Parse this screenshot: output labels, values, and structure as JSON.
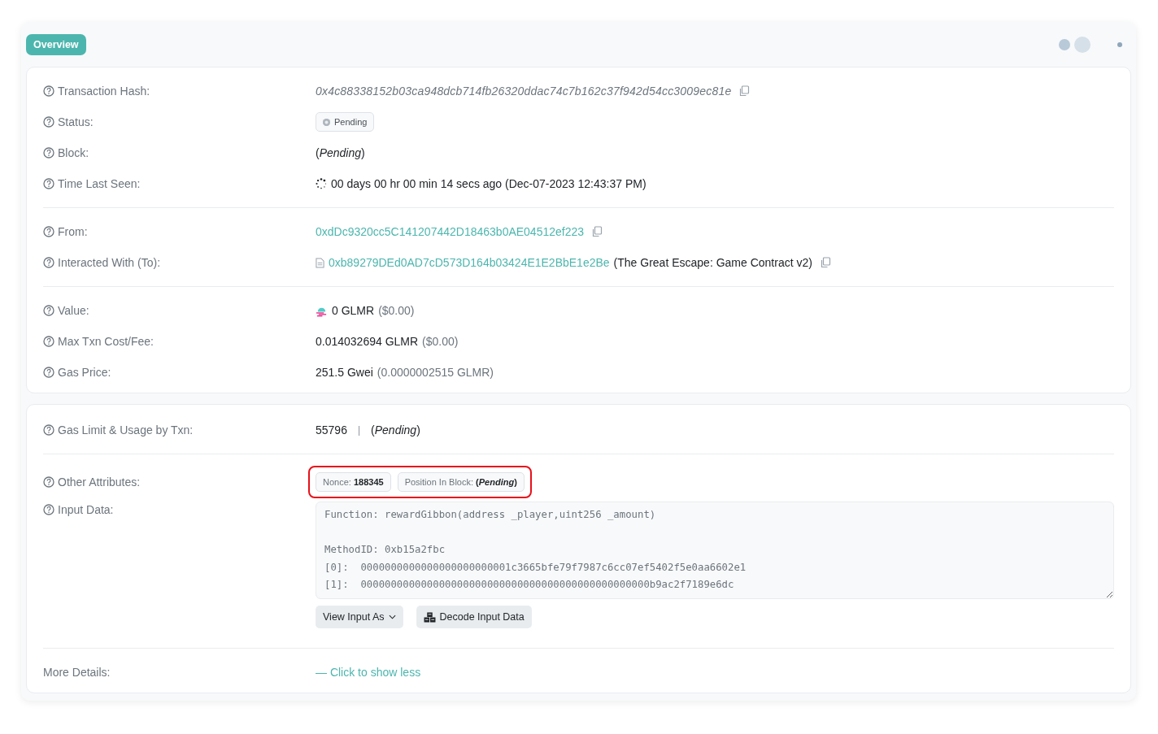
{
  "tabs": [
    {
      "label": "Overview",
      "selected": true
    }
  ],
  "overview": {
    "groups": [
      [
        {
          "kind": "hash",
          "label": "Transaction Hash:",
          "value": "0x4c88338152b03ca948dcb714fb26320ddac74c7b162c37f942d54cc3009ec81e"
        },
        {
          "kind": "status",
          "label": "Status:",
          "value": "Pending"
        },
        {
          "kind": "rich",
          "label": "Block:",
          "value": "(*Pending*)"
        },
        {
          "kind": "time",
          "label": "Time Last Seen:",
          "value": "00 days 00 hr 00 min 14 secs ago (Dec-07-2023 12:43:37 PM)"
        }
      ],
      [
        {
          "kind": "address",
          "label": "From:",
          "value": "0xdDc9320cc5C141207442D18463b0AE04512ef223"
        },
        {
          "kind": "contract",
          "label": "Interacted With (To):",
          "value": "0xb89279DEd0AD7cD573D164b03424E1E2BbE1e2Be",
          "note": "(The Great Escape: Game Contract v2)"
        }
      ],
      [
        {
          "kind": "token",
          "label": "Value:",
          "value": "0 GLMR",
          "note": "($0.00)"
        },
        {
          "kind": "amount",
          "label": "Max Txn Cost/Fee:",
          "value": "0.014032694 GLMR",
          "note": "($0.00)"
        },
        {
          "kind": "amount",
          "label": "Gas Price:",
          "value": "251.5 Gwei",
          "note": "(0.0000002515 GLMR)"
        }
      ]
    ]
  },
  "usage": {
    "gas": {
      "label": "Gas Limit & Usage by Txn:",
      "limit": "55796",
      "separator": "|",
      "usage": "(*Pending*)"
    },
    "attributes": {
      "label": "Other Attributes:",
      "highlighted": true,
      "badges": [
        {
          "label": "Nonce:",
          "value": "188345"
        },
        {
          "label": "Position In Block:",
          "value": "(*Pending*)"
        }
      ]
    },
    "input": {
      "label": "Input Data:",
      "blocks": [
        [
          "Function: rewardGibbon(address _player,uint256 _amount)"
        ],
        [
          "MethodID: 0xb15a2fbc",
          "[0]:  0000000000000000000000001c3665bfe79f7987c6cc07ef5402f5e0aa6602e1",
          "[1]:  000000000000000000000000000000000000000000000000b9ac2f7189e6dc"
        ]
      ],
      "buttons": [
        {
          "kind": "dropdown",
          "label": "View Input As"
        },
        {
          "kind": "decode",
          "label": "Decode Input Data"
        }
      ]
    },
    "more": {
      "label": "More Details:",
      "link": "— Click to show less"
    }
  }
}
